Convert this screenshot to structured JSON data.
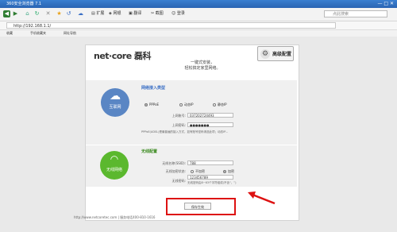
{
  "window": {
    "title": "360安全浏览器 7.1",
    "controls": "— □ ✕"
  },
  "toolbar": {
    "ext_label": "扩展",
    "bank_label": "网银",
    "translate_label": "翻译",
    "screenshot_label": "截图",
    "login_label": "登录",
    "search_placeholder": "点此搜索"
  },
  "address": {
    "url": "http://192.168.1.1/"
  },
  "favorites": {
    "fav_label": "收藏",
    "mobile_fav_label": "手机收藏夹",
    "hao_label": "网址导航"
  },
  "page": {
    "brand_name": "net·core 磊科",
    "intro_line1": "一键式安装，",
    "intro_line2": "轻松搞定家里网络。",
    "advanced_button": "高级配置",
    "wan": {
      "badge": "互联网",
      "title": "网络接入类型",
      "options": [
        "PPPoE",
        "动态IP",
        "静态IP"
      ],
      "account_label": "上网账号:",
      "account_value": "037202724493",
      "password_label": "上网密码:",
      "password_value": "●●●●●●●",
      "hint": "PPPoE(ADSL)是最普遍的接入方式，如有账号密码请选此项；动态IP..."
    },
    "wifi": {
      "badge": "无线网络",
      "title": "无线配置",
      "ssid_label": "无线名称(SSID):",
      "ssid_value": "788",
      "enc_label": "无线加密状态:",
      "enc_options": [
        "不加密",
        "加密"
      ],
      "key_label": "无线密码:",
      "key_value": "123456789",
      "key_hint": "无线密码由8~63个字符组成(不含“，”)"
    },
    "save_button": "保存生效",
    "footer": "http://www.netcoretec.com | 服务电话400-810-1616"
  },
  "colors": {
    "wan_bubble": "#5a86c4",
    "wifi_bubble": "#5bb82e",
    "highlight": "#dd1111"
  }
}
